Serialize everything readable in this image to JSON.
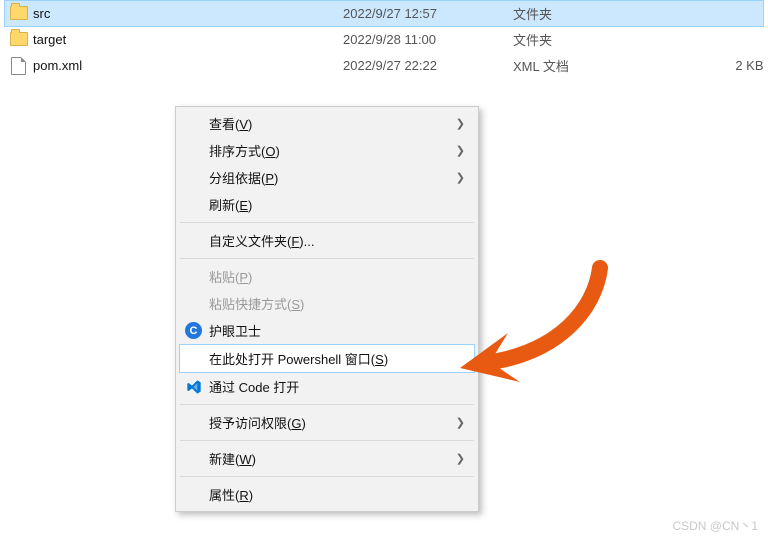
{
  "files": [
    {
      "name": "src",
      "date": "2022/9/27 12:57",
      "type": "文件夹",
      "size": "",
      "kind": "folder",
      "selected": true
    },
    {
      "name": "target",
      "date": "2022/9/28 11:00",
      "type": "文件夹",
      "size": "",
      "kind": "folder",
      "selected": false
    },
    {
      "name": "pom.xml",
      "date": "2022/9/27 22:22",
      "type": "XML 文档",
      "size": "2 KB",
      "kind": "file",
      "selected": false
    }
  ],
  "menu": {
    "view": {
      "t": "查看(",
      "u": "V",
      "a": ")"
    },
    "sort": {
      "t": "排序方式(",
      "u": "O",
      "a": ")"
    },
    "group": {
      "t": "分组依据(",
      "u": "P",
      "a": ")"
    },
    "refresh": {
      "t": "刷新(",
      "u": "E",
      "a": ")"
    },
    "customize": {
      "t": "自定义文件夹(",
      "u": "F",
      "a": ")..."
    },
    "paste": {
      "t": "粘贴(",
      "u": "P",
      "a": ")"
    },
    "pastesc": {
      "t": "粘贴快捷方式(",
      "u": "S",
      "a": ")"
    },
    "huyan": "护眼卫士",
    "ps": {
      "t": "在此处打开 Powershell 窗口(",
      "u": "S",
      "a": ")"
    },
    "code": "通过 Code 打开",
    "grant": {
      "t": "授予访问权限(",
      "u": "G",
      "a": ")"
    },
    "new": {
      "t": "新建(",
      "u": "W",
      "a": ")"
    },
    "prop": {
      "t": "属性(",
      "u": "R",
      "a": ")"
    }
  },
  "watermark": "CSDN @CN丶1"
}
